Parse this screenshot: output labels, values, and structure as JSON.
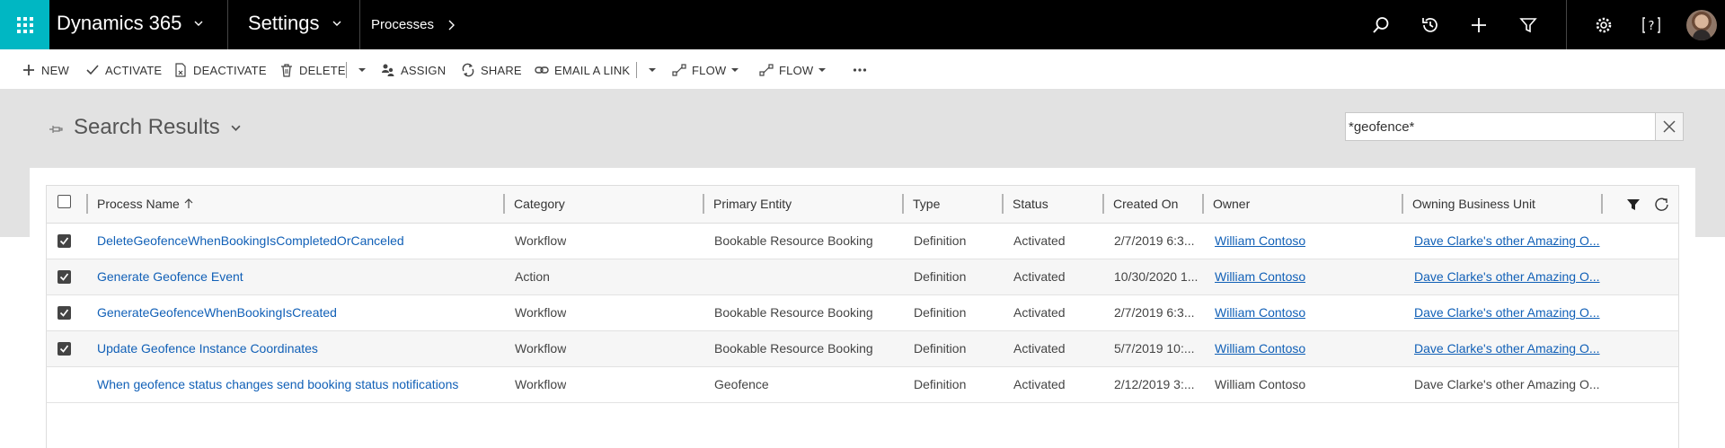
{
  "nav": {
    "app_name": "Dynamics 365",
    "area": "Settings",
    "breadcrumb": "Processes"
  },
  "commands": [
    {
      "label": "NEW",
      "icon": "plus-icon"
    },
    {
      "label": "ACTIVATE",
      "icon": "check-icon"
    },
    {
      "label": "DEACTIVATE",
      "icon": "deactivate-icon"
    },
    {
      "label": "DELETE",
      "icon": "trash-icon"
    },
    {
      "label": "ASSIGN",
      "icon": "assign-icon"
    },
    {
      "label": "SHARE",
      "icon": "share-icon"
    },
    {
      "label": "EMAIL A LINK",
      "icon": "link-icon"
    },
    {
      "label": "FLOW",
      "icon": "flow-icon"
    },
    {
      "label": "FLOW",
      "icon": "flow-icon"
    }
  ],
  "view": {
    "title": "Search Results",
    "search_value": "*geofence*"
  },
  "grid": {
    "columns": [
      "Process Name",
      "Category",
      "Primary Entity",
      "Type",
      "Status",
      "Created On",
      "Owner",
      "Owning Business Unit"
    ],
    "rows": [
      {
        "checked": true,
        "name": "DeleteGeofenceWhenBookingIsCompletedOrCanceled",
        "category": "Workflow",
        "entity": "Bookable Resource Booking",
        "type": "Definition",
        "status": "Activated",
        "created": "2/7/2019 6:3...",
        "owner": "William Contoso",
        "bu": "Dave Clarke's other Amazing O..."
      },
      {
        "checked": true,
        "name": "Generate Geofence Event",
        "category": "Action",
        "entity": "",
        "type": "Definition",
        "status": "Activated",
        "created": "10/30/2020 1...",
        "owner": "William Contoso",
        "bu": "Dave Clarke's other Amazing O..."
      },
      {
        "checked": true,
        "name": "GenerateGeofenceWhenBookingIsCreated",
        "category": "Workflow",
        "entity": "Bookable Resource Booking",
        "type": "Definition",
        "status": "Activated",
        "created": "2/7/2019 6:3...",
        "owner": "William Contoso",
        "bu": "Dave Clarke's other Amazing O..."
      },
      {
        "checked": true,
        "name": "Update Geofence Instance Coordinates",
        "category": "Workflow",
        "entity": "Bookable Resource Booking",
        "type": "Definition",
        "status": "Activated",
        "created": "5/7/2019 10:...",
        "owner": "William Contoso",
        "bu": "Dave Clarke's other Amazing O..."
      },
      {
        "checked": false,
        "name": "When geofence status changes send booking status notifications",
        "category": "Workflow",
        "entity": "Geofence",
        "type": "Definition",
        "status": "Activated",
        "created": "2/12/2019 3:...",
        "owner": "William Contoso",
        "bu": "Dave Clarke's other Amazing O..."
      }
    ]
  }
}
